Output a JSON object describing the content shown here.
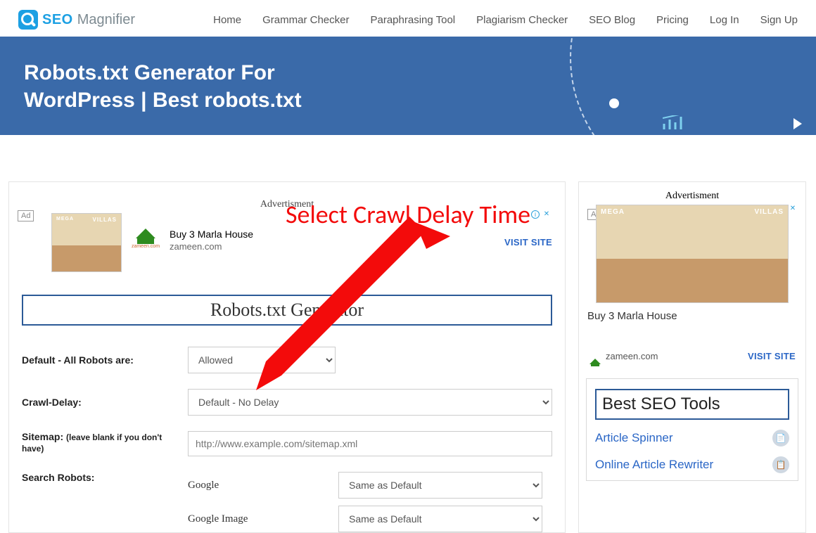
{
  "logo": {
    "part1": "SEO",
    "part2": "Magnifier"
  },
  "nav": {
    "home": "Home",
    "grammar": "Grammar Checker",
    "paraphrase": "Paraphrasing Tool",
    "plagiarism": "Plagiarism Checker",
    "blog": "SEO Blog",
    "pricing": "Pricing",
    "login": "Log In",
    "signup": "Sign Up"
  },
  "hero": {
    "title": "Robots.txt Generator For WordPress | Best robots.txt"
  },
  "main": {
    "ad_label": "Advertisment",
    "ad_tag": "Ad",
    "ad_title": "Buy 3 Marla House",
    "ad_source": "zameen.com",
    "ad_cta": "VISIT SITE",
    "tool_title": "Robots.txt Generator",
    "form": {
      "default_robots_label": "Default - All Robots are:",
      "default_robots_value": "Allowed",
      "crawl_delay_label": "Crawl-Delay:",
      "crawl_delay_value": "Default - No Delay",
      "sitemap_label": "Sitemap:",
      "sitemap_hint": "(leave blank if you don't have)",
      "sitemap_placeholder": "http://www.example.com/sitemap.xml",
      "search_robots_label": "Search Robots:",
      "robots": [
        {
          "name": "Google",
          "value": "Same as Default"
        },
        {
          "name": "Google Image",
          "value": "Same as Default"
        }
      ]
    }
  },
  "sidebar": {
    "ad_label": "Advertisment",
    "ad_tag": "Ad",
    "ad_title": "Buy 3 Marla House",
    "ad_source": "zameen.com",
    "ad_cta": "VISIT SITE",
    "tools_heading": "Best SEO Tools",
    "tools": [
      {
        "label": "Article Spinner"
      },
      {
        "label": "Online Article Rewriter"
      }
    ]
  },
  "annotation": {
    "text": "Select Crawl Delay Time"
  }
}
